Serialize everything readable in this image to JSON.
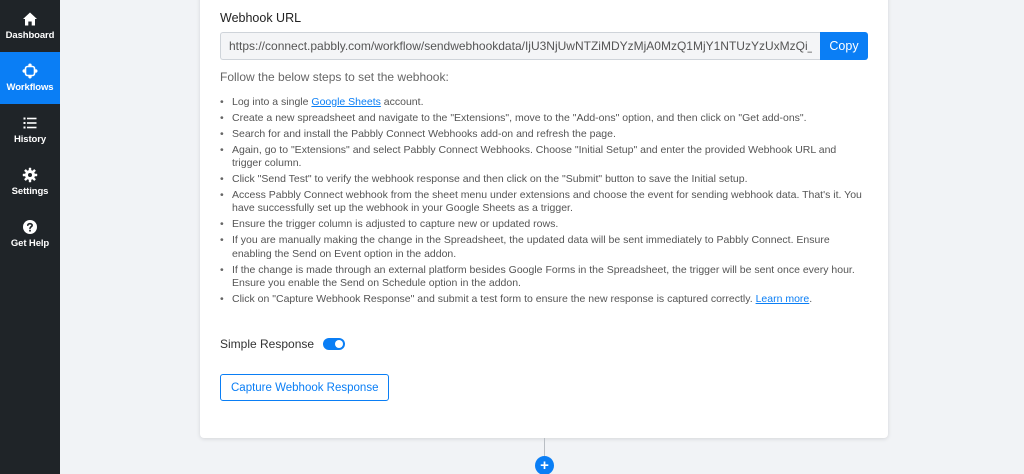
{
  "sidebar": {
    "items": [
      {
        "label": "Dashboard",
        "icon": "home-icon",
        "active": false
      },
      {
        "label": "Workflows",
        "icon": "workflow-icon",
        "active": true
      },
      {
        "label": "History",
        "icon": "history-icon",
        "active": false
      },
      {
        "label": "Settings",
        "icon": "gear-icon",
        "active": false
      },
      {
        "label": "Get Help",
        "icon": "help-icon",
        "active": false
      }
    ]
  },
  "webhook": {
    "label": "Webhook URL",
    "url": "https://connect.pabbly.com/workflow/sendwebhookdata/IjU3NjUwNTZiMDYzMjA0MzQ1MjY1NTUzYzUxMzQi_",
    "copy_label": "Copy"
  },
  "instructions": {
    "intro": "Follow the below steps to set the webhook:",
    "steps": {
      "s1_pre": "Log into a single ",
      "s1_link": "Google Sheets",
      "s1_post": " account.",
      "s2": "Create a new spreadsheet and navigate to the \"Extensions\", move to the \"Add-ons\" option, and then click on \"Get add-ons\".",
      "s3": "Search for and install the Pabbly Connect Webhooks add-on and refresh the page.",
      "s4": "Again, go to \"Extensions\" and select Pabbly Connect Webhooks. Choose \"Initial Setup\" and enter the provided Webhook URL and trigger column.",
      "s5": "Click \"Send Test\" to verify the webhook response and then click on the \"Submit\" button to save the Initial setup.",
      "s6": "Access Pabbly Connect webhook from the sheet menu under extensions and choose the event for sending webhook data. That's it. You have successfully set up the webhook in your Google Sheets as a trigger.",
      "s7": "Ensure the trigger column is adjusted to capture new or updated rows.",
      "s8": "If you are manually making the change in the Spreadsheet, the updated data will be sent immediately to Pabbly Connect. Ensure enabling the Send on Event option in the addon.",
      "s9": "If the change is made through an external platform besides Google Forms in the Spreadsheet, the trigger will be sent once every hour. Ensure you enable the Send on Schedule option in the addon.",
      "s10_pre": "Click on \"Capture Webhook Response\" and submit a test form to ensure the new response is captured correctly. ",
      "s10_link": "Learn more",
      "s10_post": "."
    }
  },
  "simple_response": {
    "label": "Simple Response",
    "enabled": true
  },
  "capture_button": "Capture Webhook Response",
  "add_step_symbol": "+",
  "colors": {
    "accent": "#0a7ef5",
    "sidebar_bg": "#1f2428",
    "page_bg": "#f1f3f6"
  }
}
